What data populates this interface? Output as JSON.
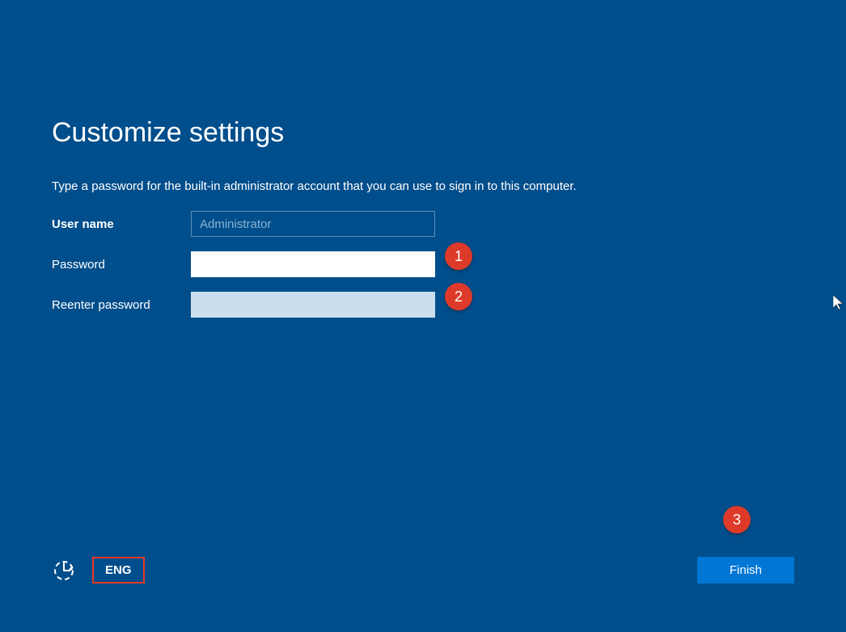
{
  "page": {
    "title": "Customize settings",
    "instruction": "Type a password for the built-in administrator account that you can use to sign in to this computer."
  },
  "form": {
    "username": {
      "label": "User name",
      "placeholder": "Administrator",
      "value": ""
    },
    "password": {
      "label": "Password",
      "value": ""
    },
    "reenter": {
      "label": "Reenter password",
      "value": ""
    }
  },
  "annotations": {
    "badge1": "1",
    "badge2": "2",
    "badge3": "3"
  },
  "bottom": {
    "language": "ENG",
    "finish": "Finish"
  }
}
